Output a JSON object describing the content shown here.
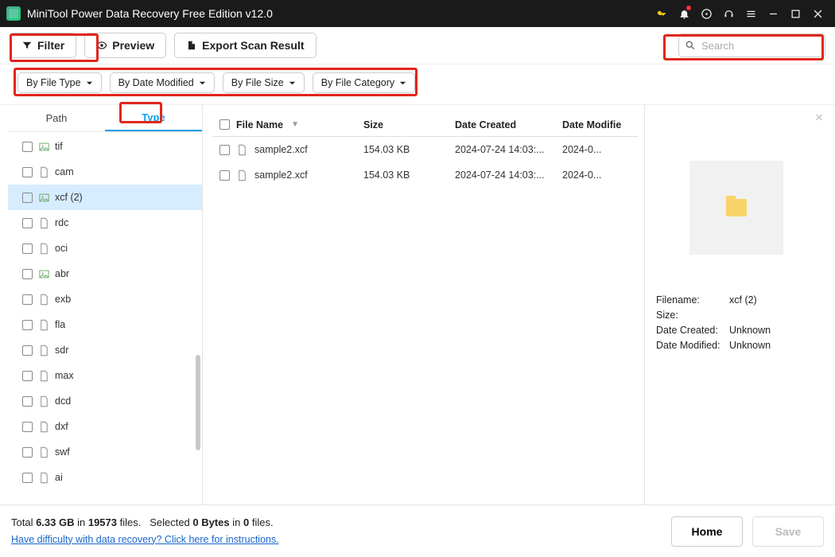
{
  "title": "MiniTool Power Data Recovery Free Edition v12.0",
  "toolbar": {
    "filter": "Filter",
    "preview": "Preview",
    "export": "Export Scan Result"
  },
  "search": {
    "placeholder": "Search"
  },
  "chips": [
    "By File Type",
    "By Date Modified",
    "By File Size",
    "By File Category"
  ],
  "tabs": {
    "path": "Path",
    "type": "Type"
  },
  "tree": [
    {
      "label": "tif",
      "img": true
    },
    {
      "label": "cam"
    },
    {
      "label": "xcf (2)",
      "img": true,
      "sel": true
    },
    {
      "label": "rdc"
    },
    {
      "label": "oci"
    },
    {
      "label": "abr",
      "img": true
    },
    {
      "label": "exb"
    },
    {
      "label": "fla"
    },
    {
      "label": "sdr"
    },
    {
      "label": "max"
    },
    {
      "label": "dcd"
    },
    {
      "label": "dxf"
    },
    {
      "label": "swf"
    },
    {
      "label": "ai"
    }
  ],
  "columns": {
    "name": "File Name",
    "size": "Size",
    "created": "Date Created",
    "modified": "Date Modifie"
  },
  "rows": [
    {
      "name": "sample2.xcf",
      "size": "154.03 KB",
      "created": "2024-07-24 14:03:...",
      "modified": "2024-0..."
    },
    {
      "name": "sample2.xcf",
      "size": "154.03 KB",
      "created": "2024-07-24 14:03:...",
      "modified": "2024-0..."
    }
  ],
  "detail": {
    "labels": {
      "filename": "Filename:",
      "size": "Size:",
      "created": "Date Created:",
      "modified": "Date Modified:"
    },
    "filename": "xcf (2)",
    "size": "",
    "created": "Unknown",
    "modified": "Unknown"
  },
  "footer": {
    "prefix": "Total ",
    "total_size": "6.33 GB",
    "in1": " in ",
    "total_files": "19573",
    "files_word": " files.",
    "sel_prefix": "Selected ",
    "sel_size": "0 Bytes",
    "in2": " in ",
    "sel_files": "0",
    "files_word2": " files.",
    "help": "Have difficulty with data recovery? Click here for instructions.",
    "home": "Home",
    "save": "Save"
  }
}
